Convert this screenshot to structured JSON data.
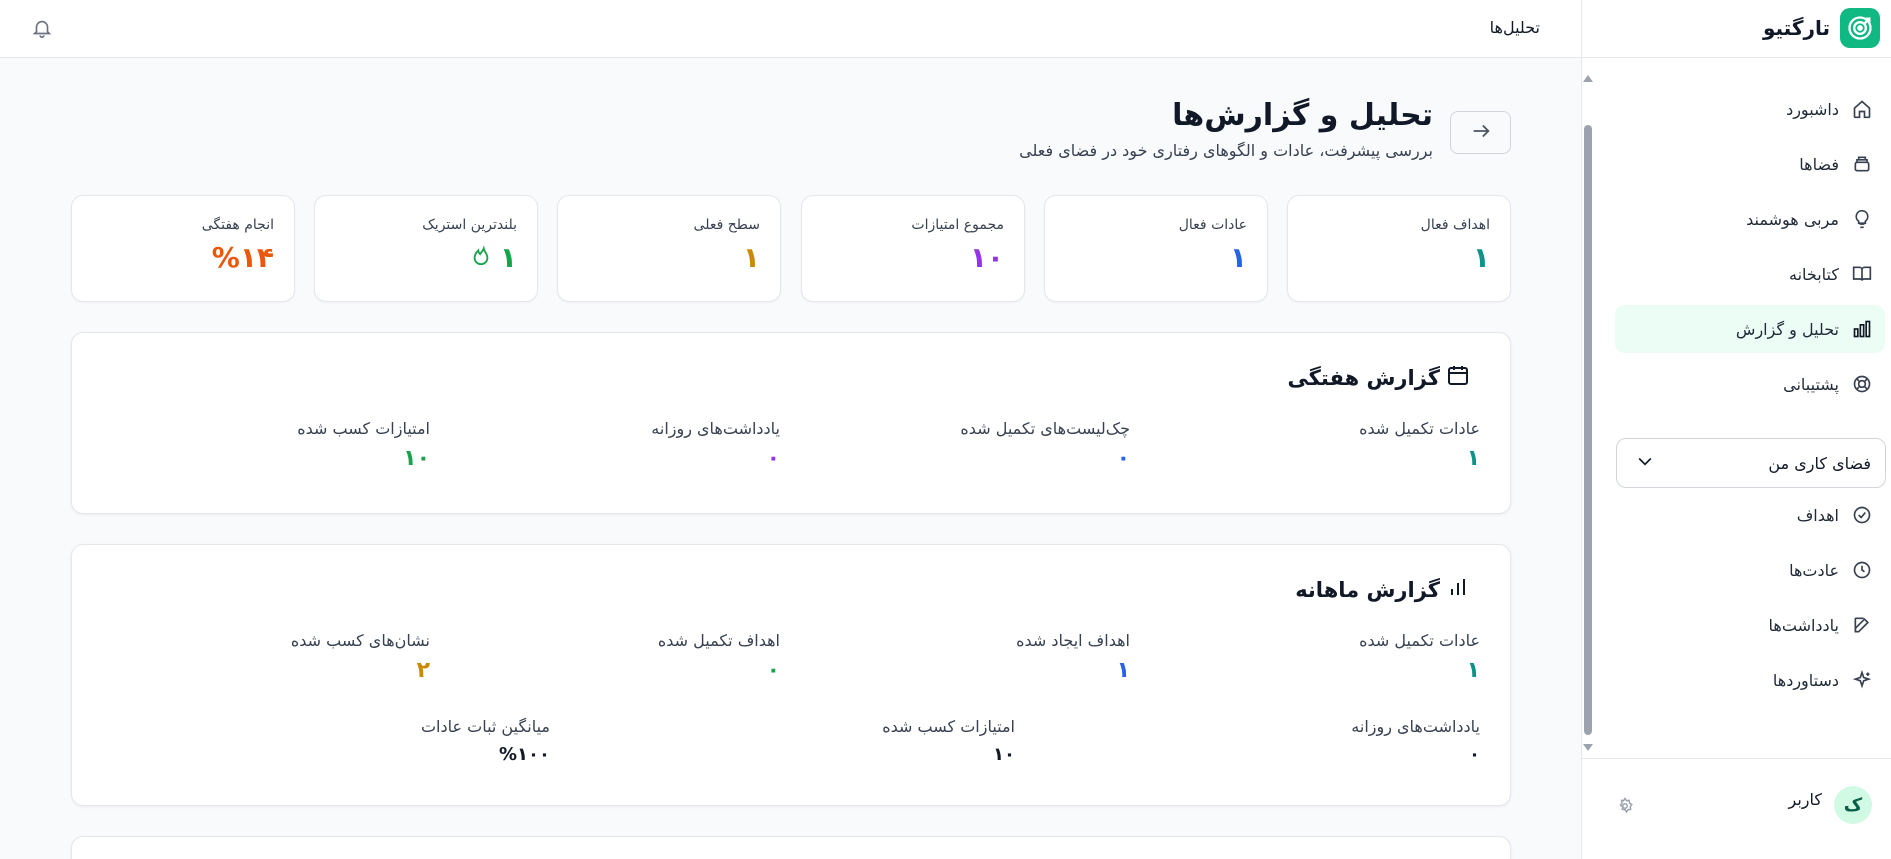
{
  "brand": {
    "name": "تارگتیو"
  },
  "topbar": {
    "title": "تحلیل‌ها"
  },
  "nav": {
    "items": [
      {
        "label": "داشبورد",
        "icon": "home-icon"
      },
      {
        "label": "فضاها",
        "icon": "layers-icon"
      },
      {
        "label": "مربی هوشمند",
        "icon": "lightbulb-icon"
      },
      {
        "label": "کتابخانه",
        "icon": "book-icon"
      },
      {
        "label": "تحلیل و گزارش",
        "icon": "bar-chart-icon",
        "active": true
      },
      {
        "label": "پشتیبانی",
        "icon": "lifebuoy-icon"
      }
    ],
    "workspace": {
      "label": "فضای کاری من"
    },
    "workspace_items": [
      {
        "label": "اهداف",
        "icon": "check-circle-icon"
      },
      {
        "label": "عادت‌ها",
        "icon": "clock-icon"
      },
      {
        "label": "یادداشت‌ها",
        "icon": "edit-icon"
      },
      {
        "label": "دستاوردها",
        "icon": "sparkles-icon"
      }
    ]
  },
  "user": {
    "name": "کاربر",
    "initial": "ک"
  },
  "header": {
    "title": "تحلیل و گزارش‌ها",
    "subtitle": "بررسی پیشرفت، عادات و الگوهای رفتاری خود در فضای فعلی"
  },
  "stats": [
    {
      "label": "اهداف فعال",
      "value": "۱",
      "color": "#0d9488"
    },
    {
      "label": "عادات فعال",
      "value": "۱",
      "color": "#2563eb"
    },
    {
      "label": "مجموع امتیازات",
      "value": "۱۰",
      "color": "#9333ea"
    },
    {
      "label": "سطح فعلی",
      "value": "۱",
      "color": "#ca8a04"
    },
    {
      "label": "بلندترین استریک",
      "value": "۱",
      "color": "#16a34a"
    },
    {
      "label": "انجام هفتگی",
      "value": "%۱۴",
      "color": "#ea580c"
    }
  ],
  "weekly": {
    "title": "گزارش هفتگی",
    "metrics": [
      {
        "label": "عادات تکمیل شده",
        "value": "۱",
        "color": "#0d9488"
      },
      {
        "label": "چک‌لیست‌های تکمیل شده",
        "value": "۰",
        "color": "#2563eb"
      },
      {
        "label": "یادداشت‌های روزانه",
        "value": "۰",
        "color": "#9333ea"
      },
      {
        "label": "امتیازات کسب شده",
        "value": "۱۰",
        "color": "#16a34a"
      }
    ]
  },
  "monthly": {
    "title": "گزارش ماهانه",
    "metrics": [
      {
        "label": "عادات تکمیل شده",
        "value": "۱",
        "color": "#0d9488"
      },
      {
        "label": "اهداف ایجاد شده",
        "value": "۱",
        "color": "#2563eb"
      },
      {
        "label": "اهداف تکمیل شده",
        "value": "۰",
        "color": "#16a34a"
      },
      {
        "label": "نشان‌های کسب شده",
        "value": "۲",
        "color": "#ca8a04"
      }
    ],
    "secondary": [
      {
        "label": "یادداشت‌های روزانه",
        "value": "۰"
      },
      {
        "label": "امتیازات کسب شده",
        "value": "۱۰"
      },
      {
        "label": "میانگین ثبات عادات",
        "value": "%۱۰۰"
      }
    ]
  }
}
